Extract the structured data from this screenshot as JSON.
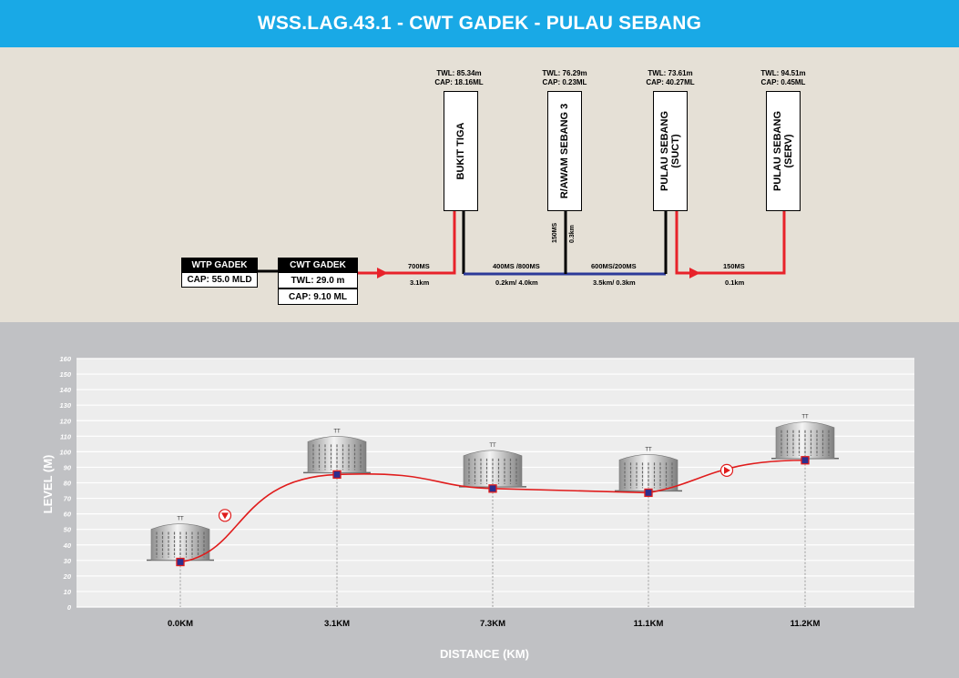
{
  "title": "WSS.LAG.43.1 - CWT GADEK - PULAU SEBANG",
  "schematic": {
    "wtp": {
      "label": "WTP GADEK",
      "cap": "CAP: 55.0 MLD"
    },
    "cwt": {
      "label": "CWT GADEK",
      "twl": "TWL: 29.0 m",
      "cap": "CAP: 9.10 ML"
    },
    "tanks": [
      {
        "name": "BUKIT TIGA",
        "twl": "TWL: 85.34m",
        "cap": "CAP: 18.16ML"
      },
      {
        "name": "R/AWAM SEBANG 3",
        "twl": "TWL: 76.29m",
        "cap": "CAP: 0.23ML"
      },
      {
        "name": "PULAU SEBANG\n(SUCT)",
        "twl": "TWL: 73.61m",
        "cap": "CAP: 40.27ML"
      },
      {
        "name": "PULAU SEBANG\n(SERV)",
        "twl": "TWL: 94.51m",
        "cap": "CAP: 0.45ML"
      }
    ],
    "pipes": [
      {
        "size": "700MS",
        "length": "3.1km"
      },
      {
        "size": "400MS /800MS",
        "length": "0.2km/ 4.0km"
      },
      {
        "size": "600MS/200MS",
        "length": "3.5km/ 0.3km"
      },
      {
        "size": "150MS",
        "length": "0.1km"
      }
    ],
    "branch": {
      "size": "150MS",
      "length": "0.3km"
    }
  },
  "chart_data": {
    "type": "line",
    "xlabel": "DISTANCE (KM)",
    "ylabel": "LEVEL (M)",
    "ylim": [
      0,
      160
    ],
    "yticks": [
      0,
      10,
      20,
      30,
      40,
      50,
      60,
      70,
      80,
      90,
      100,
      110,
      120,
      130,
      140,
      150,
      160
    ],
    "categories": [
      "0.0KM",
      "3.1KM",
      "7.3KM",
      "11.1KM",
      "11.2KM"
    ],
    "values": [
      29.0,
      85.34,
      76.29,
      73.61,
      94.51
    ],
    "pump_points": [
      {
        "after_index": 0,
        "level": 59
      },
      {
        "after_index": 3,
        "level": 88
      }
    ],
    "grid": true,
    "colors": {
      "line": "#e01c1c",
      "marker": "#2b2f8f",
      "pump": "#e01c1c"
    }
  }
}
